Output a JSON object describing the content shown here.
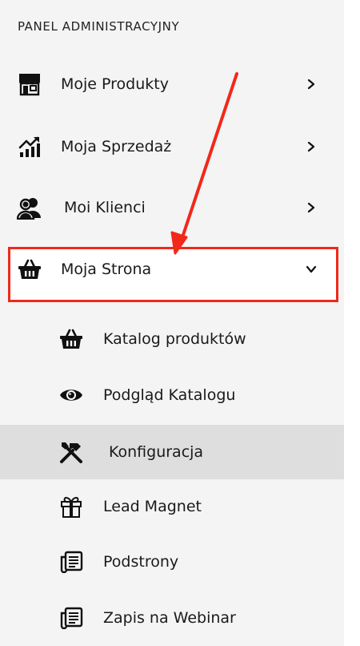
{
  "panel": {
    "title": "PANEL ADMINISTRACYJNY"
  },
  "menu": [
    {
      "label": "Moje Produkty",
      "icon": "store-icon",
      "expanded": false
    },
    {
      "label": "Moja Sprzedaż",
      "icon": "sales-chart-icon",
      "expanded": false
    },
    {
      "label": "Moi Klienci",
      "icon": "clients-icon",
      "expanded": false
    },
    {
      "label": "Moja Strona",
      "icon": "basket-icon",
      "expanded": true,
      "highlighted": true
    }
  ],
  "submenu": [
    {
      "label": "Katalog produktów",
      "icon": "basket-icon",
      "active": false
    },
    {
      "label": "Podgląd Katalogu",
      "icon": "eye-icon",
      "active": false
    },
    {
      "label": "Konfiguracja",
      "icon": "tools-icon",
      "active": true
    },
    {
      "label": "Lead Magnet",
      "icon": "gift-icon",
      "active": false
    },
    {
      "label": "Podstrony",
      "icon": "pages-icon",
      "active": false
    },
    {
      "label": "Zapis na Webinar",
      "icon": "pages-icon",
      "active": false
    }
  ],
  "annotation": {
    "arrow_color": "#f1291a",
    "highlight_color": "#f1291a"
  }
}
